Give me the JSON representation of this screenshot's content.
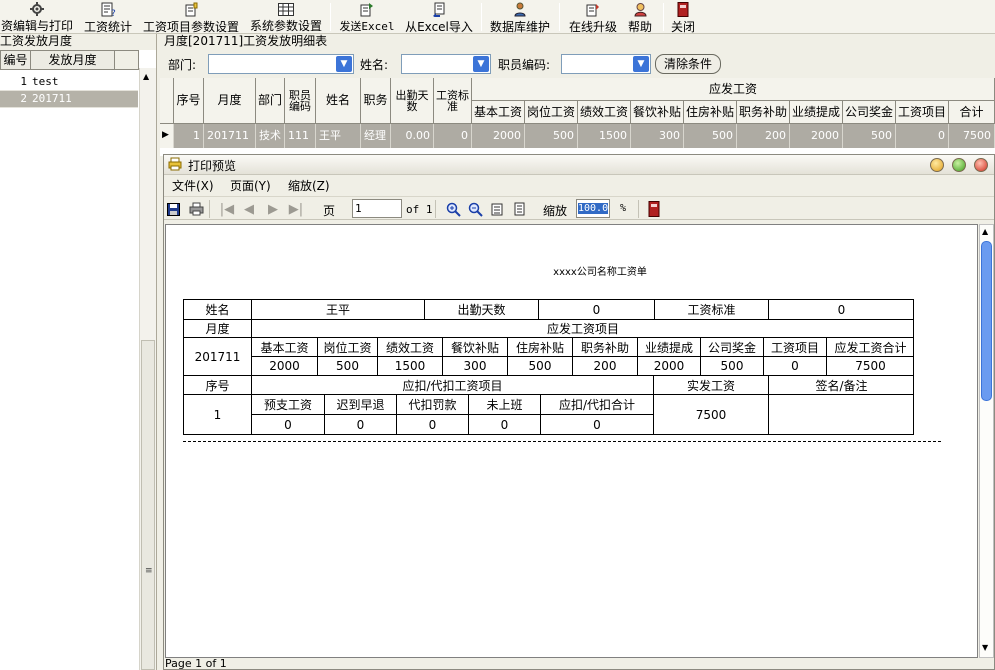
{
  "toolbar": {
    "items": [
      {
        "label": "资编辑与打印",
        "icon": "gear-icon"
      },
      {
        "label": "工资统计",
        "icon": "report-icon"
      },
      {
        "label": "工资项目参数设置",
        "icon": "settings-icon"
      },
      {
        "label": "系统参数设置",
        "icon": "table-icon"
      },
      {
        "label": "发送Excel",
        "icon": "excel-send-icon"
      },
      {
        "label": "从Excel导入",
        "icon": "excel-import-icon"
      },
      {
        "label": "数据库维护",
        "icon": "database-user-icon"
      },
      {
        "label": "在线升级",
        "icon": "upgrade-icon"
      },
      {
        "label": "帮助",
        "icon": "help-icon"
      },
      {
        "label": "关闭",
        "icon": "close-door-icon"
      }
    ]
  },
  "left_panel": {
    "caption": "工资发放月度",
    "columns": [
      "编号",
      "发放月度"
    ],
    "rows": [
      {
        "id": "1",
        "month": "test",
        "selected": false
      },
      {
        "id": "2",
        "month": "201711",
        "selected": true
      }
    ]
  },
  "right_panel": {
    "caption": "月度[201711]工资发放明细表",
    "filters": {
      "dept_label": "部门:",
      "name_label": "姓名:",
      "code_label": "职员编码:",
      "clear_label": "清除条件"
    },
    "grid": {
      "group_header": "应发工资",
      "columns": [
        "序号",
        "月度",
        "部门",
        "职员编码",
        "姓名",
        "职务",
        "出勤天数",
        "工资标准",
        "基本工资",
        "岗位工资",
        "绩效工资",
        "餐饮补贴",
        "住房补贴",
        "职务补助",
        "业绩提成",
        "公司奖金",
        "工资项目",
        "合计"
      ],
      "row": [
        "1",
        "201711",
        "技术",
        "111",
        "王平",
        "经理",
        "0.00",
        "0",
        "2000",
        "500",
        "1500",
        "300",
        "500",
        "200",
        "2000",
        "500",
        "0",
        "7500"
      ]
    }
  },
  "preview": {
    "title": "打印预览",
    "menu": [
      "文件(X)",
      "页面(Y)",
      "缩放(Z)"
    ],
    "page_label": "页",
    "page_value": "1",
    "of_label": "of 1",
    "zoom_label": "缩放",
    "zoom_value": "100.0",
    "percent": "%",
    "status": "Page 1 of 1",
    "slip": {
      "title": "xxxx公司名称工资单",
      "name_label": "姓名",
      "name_value": "王平",
      "attendance_label": "出勤天数",
      "attendance_value": "0",
      "standard_label": "工资标准",
      "standard_value": "0",
      "month_label": "月度",
      "month_value": "201711",
      "payable_header": "应发工资项目",
      "payable_items": [
        "基本工资",
        "岗位工资",
        "绩效工资",
        "餐饮补贴",
        "住房补贴",
        "职务补助",
        "业绩提成",
        "公司奖金",
        "工资项目",
        "应发工资合计"
      ],
      "payable_values": [
        "2000",
        "500",
        "1500",
        "300",
        "500",
        "200",
        "2000",
        "500",
        "0",
        "7500"
      ],
      "seq_label": "序号",
      "seq_value": "1",
      "deduct_header": "应扣/代扣工资项目",
      "deduct_items": [
        "预支工资",
        "迟到早退",
        "代扣罚款",
        "未上班",
        "应扣/代扣合计"
      ],
      "deduct_values": [
        "0",
        "0",
        "0",
        "0",
        "0"
      ],
      "net_label": "实发工资",
      "net_value": "7500",
      "sign_label": "签名/备注"
    }
  }
}
